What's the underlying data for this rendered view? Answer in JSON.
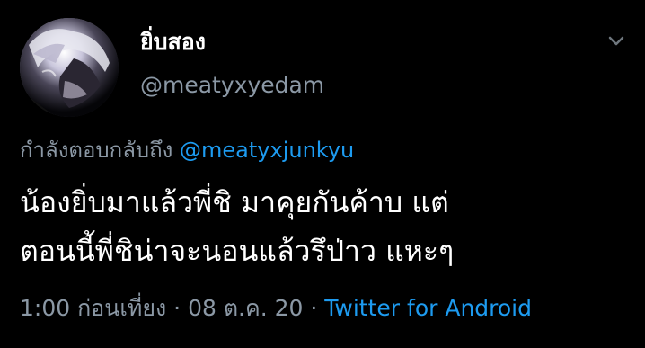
{
  "author": {
    "display_name": "ยิ่บสอง",
    "username": "@meatyxyedam"
  },
  "reply": {
    "prefix": "กำลังตอบกลับถึง",
    "mention": "@meatyxjunkyu"
  },
  "tweet": {
    "line1": "น้องยิ่บมาแล้วพี่ชิ มาคุยกันค้าบ แต่",
    "line2": "ตอนนี้พี่ชิน่าจะนอนแล้วรึป่าว แหะๆ"
  },
  "meta": {
    "time": "1:00 ก่อนเที่ยง",
    "separator1": " · ",
    "date": "08 ต.ค. 20",
    "separator2": " · ",
    "source": "Twitter for Android"
  },
  "icons": {
    "menu": "chevron-down-icon"
  },
  "colors": {
    "background": "#000000",
    "text": "#ffffff",
    "secondary": "#8b98a5",
    "link": "#1d9bf0"
  }
}
